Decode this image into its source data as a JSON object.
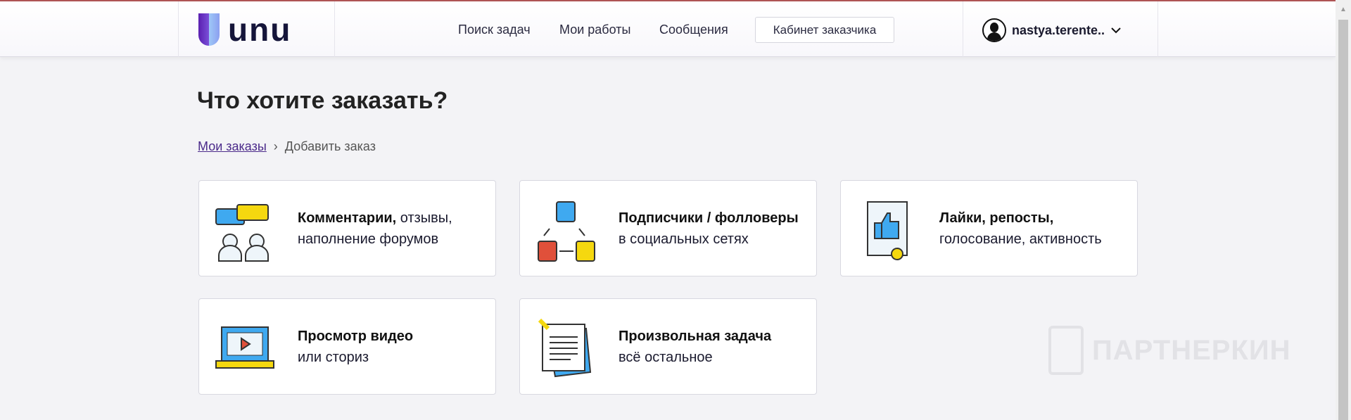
{
  "header": {
    "logo": "unu",
    "nav": [
      "Поиск задач",
      "Мои работы",
      "Сообщения"
    ],
    "cabinet_button": "Кабинет заказчика",
    "username": "nastya.terente.."
  },
  "page": {
    "title": "Что хотите заказать?",
    "breadcrumb": {
      "link": "Мои заказы",
      "current": "Добавить заказ"
    }
  },
  "cards": [
    {
      "bold": "Комментарии,",
      "rest": " отзывы,",
      "line2": "наполнение форумов"
    },
    {
      "bold": "Подписчики / фолловеры",
      "rest": "",
      "line2": "в социальных сетях"
    },
    {
      "bold": "Лайки, репосты,",
      "rest": "",
      "line2": "голосование, активность"
    },
    {
      "bold": "Просмотр видео",
      "rest": "",
      "line2": "или сториз"
    },
    {
      "bold": "Произвольная задача",
      "rest": "",
      "line2": "всё остальное"
    }
  ],
  "watermark": "ПАРТНЕРКИН"
}
